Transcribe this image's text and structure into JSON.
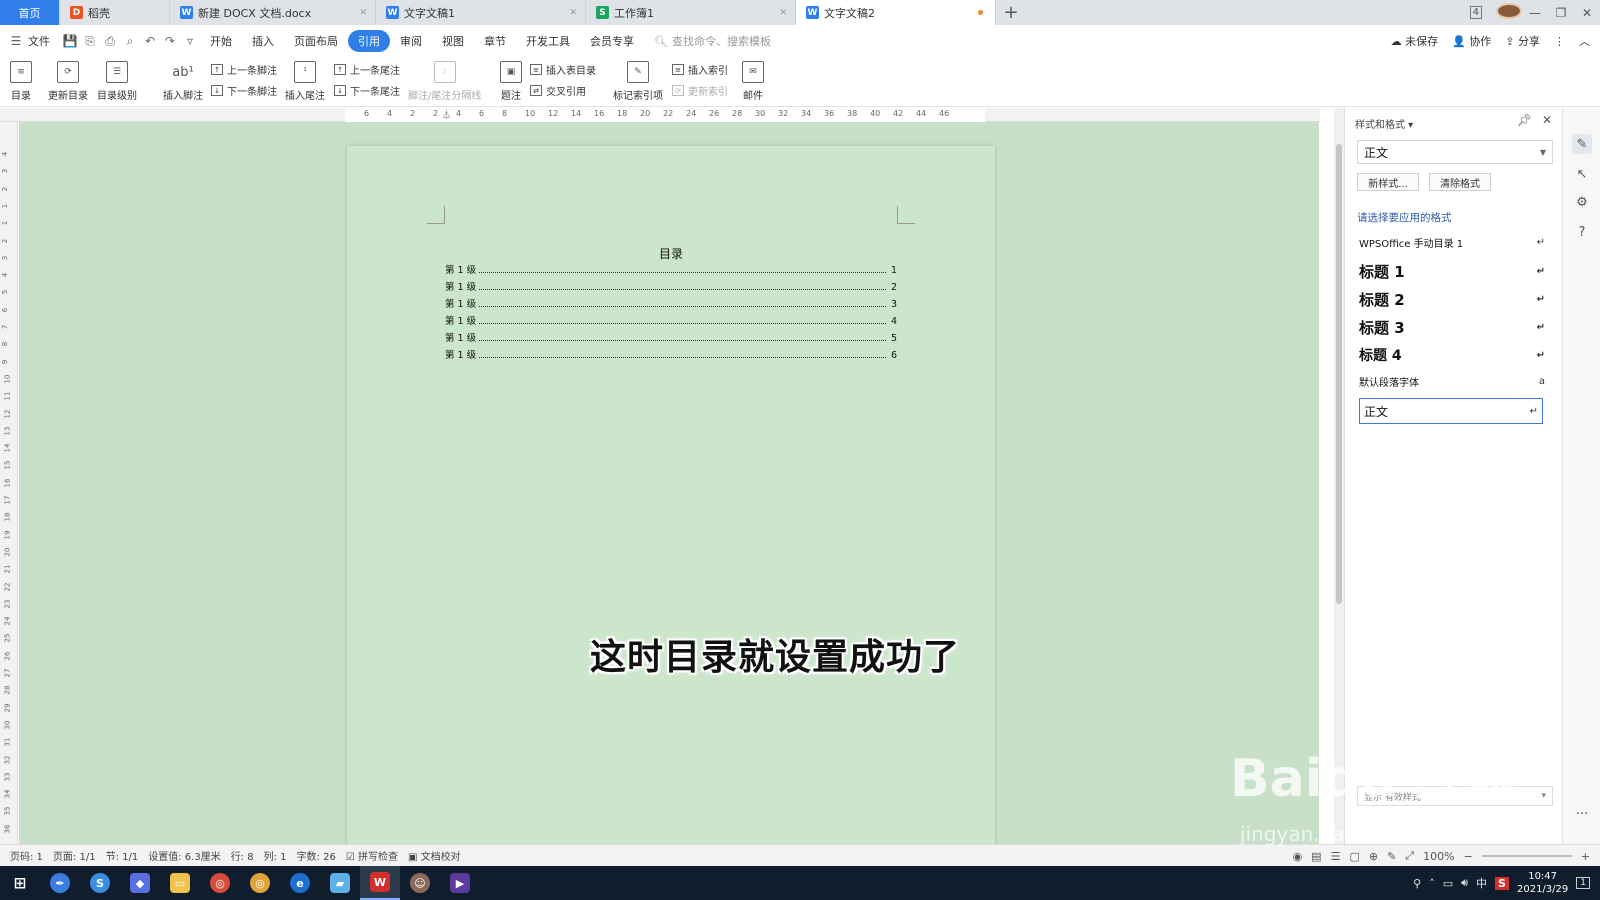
{
  "tabs": [
    {
      "label": "首页",
      "kind": "home"
    },
    {
      "label": "稻壳",
      "icon": "docer-icon",
      "color": "#e8531f"
    },
    {
      "label": "新建 DOCX 文档.docx",
      "icon": "writer-icon",
      "color": "#2f7ee9"
    },
    {
      "label": "文字文稿1",
      "icon": "writer-icon",
      "color": "#2f7ee9"
    },
    {
      "label": "工作簿1",
      "icon": "sheet-icon",
      "color": "#1aa55f"
    },
    {
      "label": "文字文稿2",
      "icon": "writer-icon",
      "color": "#2f7ee9",
      "active": true
    }
  ],
  "tab_badge": "4",
  "menubar": {
    "file": "文件",
    "items": [
      "开始",
      "插入",
      "页面布局",
      "引用",
      "审阅",
      "视图",
      "章节",
      "开发工具",
      "会员专享"
    ],
    "active": "引用",
    "search_placeholder": "查找命令、搜索模板",
    "right": {
      "unsaved": "未保存",
      "collab": "协作",
      "share": "分享"
    }
  },
  "ribbon": {
    "toc": "目录",
    "update_toc": "更新目录",
    "toc_level": "目录级别",
    "insert_footnote": "插入脚注",
    "prev_footnote": "上一条脚注",
    "next_footnote": "下一条脚注",
    "insert_endnote": "插入尾注",
    "prev_endnote": "上一条尾注",
    "next_endnote": "下一条尾注",
    "footnote_sep": "脚注/尾注分隔线",
    "caption": "题注",
    "insert_figure_toc": "插入表目录",
    "cross_ref": "交叉引用",
    "mark_index": "标记索引项",
    "insert_index": "插入索引",
    "update_index": "更新索引",
    "mail": "邮件"
  },
  "ruler_h": [
    "6",
    "4",
    "2",
    "2",
    "4",
    "6",
    "8",
    "10",
    "12",
    "14",
    "16",
    "18",
    "20",
    "22",
    "24",
    "26",
    "28",
    "30",
    "32",
    "34",
    "36",
    "38",
    "40",
    "42",
    "44",
    "46"
  ],
  "ruler_v": [
    "4",
    "3",
    "2",
    "1",
    "1",
    "2",
    "3",
    "4",
    "5",
    "6",
    "7",
    "8",
    "9",
    "10",
    "11",
    "12",
    "13",
    "14",
    "15",
    "16",
    "17",
    "18",
    "19",
    "20",
    "21",
    "22",
    "23",
    "24",
    "25",
    "26",
    "27",
    "28",
    "29",
    "30",
    "31",
    "32",
    "33",
    "34",
    "35",
    "36"
  ],
  "document": {
    "toc_title": "目录",
    "entries": [
      {
        "label": "第 1 级",
        "page": "1"
      },
      {
        "label": "第 1 级",
        "page": "2"
      },
      {
        "label": "第 1 级",
        "page": "3"
      },
      {
        "label": "第 1 级",
        "page": "4"
      },
      {
        "label": "第 1 级",
        "page": "5"
      },
      {
        "label": "第 1 级",
        "page": "6"
      }
    ],
    "subtitle": "这时目录就设置成功了"
  },
  "styles_panel": {
    "header": "样式和格式",
    "current": "正文",
    "new_style": "新样式...",
    "clear_format": "清除格式",
    "hint": "请选择要应用的格式",
    "styles": [
      {
        "label": "WPSOffice 手动目录 1",
        "kind": "small"
      },
      {
        "label": "标题 1",
        "kind": "h"
      },
      {
        "label": "标题 2",
        "kind": "h"
      },
      {
        "label": "标题 3",
        "kind": "h"
      },
      {
        "label": "标题 4",
        "kind": "h4"
      },
      {
        "label": "默认段落字体",
        "kind": "small"
      },
      {
        "label": "正文",
        "kind": "selected"
      }
    ],
    "footer": "显示 有效样式"
  },
  "statusbar": {
    "page_no": "页码: 1",
    "pages": "页面: 1/1",
    "section": "节: 1/1",
    "setting": "设置值: 6.3厘米",
    "row": "行: 8",
    "col": "列: 1",
    "words": "字数: 26",
    "spell": "拼写检查",
    "proof": "文档校对",
    "zoom": "100%"
  },
  "taskbar": {
    "time": "10:47",
    "date": "2021/3/29",
    "ime": "中",
    "notif": "1"
  },
  "watermark": {
    "main": "Baidu 经验",
    "sub": "jingyan.baidu.com"
  }
}
